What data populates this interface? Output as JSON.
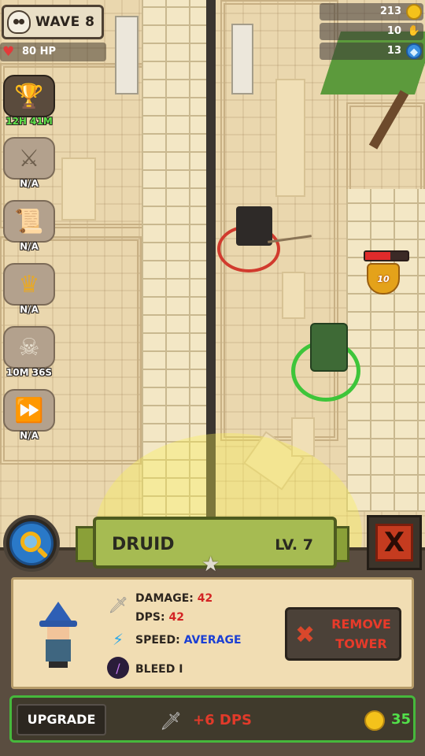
{
  "hud": {
    "wave_label": "WAVE 8",
    "hp_label": "80 HP"
  },
  "resources": [
    {
      "value": "213",
      "icon": "coin-icon"
    },
    {
      "value": "10",
      "icon": "hand-icon"
    },
    {
      "value": "13",
      "icon": "gem-icon"
    }
  ],
  "abilities": [
    {
      "label": "12H 41M",
      "icon": "trophy-icon",
      "active": true
    },
    {
      "label": "N/A",
      "icon": "crossed-swords-icon"
    },
    {
      "label": "N/A",
      "icon": "scroll-icon"
    },
    {
      "label": "N/A",
      "icon": "crown-icon"
    },
    {
      "label": "10M 36S",
      "icon": "skull-icon"
    },
    {
      "label": "N/A",
      "icon": "fast-forward-icon"
    }
  ],
  "enemy": {
    "damage_popup": "10",
    "health_fraction": 0.6
  },
  "tower": {
    "name": "DRUID",
    "level": "LV. 7",
    "stats": {
      "damage_label": "DAMAGE:",
      "damage_value": "42",
      "dps_label": "DPS:",
      "dps_value": "42",
      "speed_label": "SPEED:",
      "speed_value": "AVERAGE",
      "effect": "BLEED I"
    },
    "remove_label_line1": "REMOVE",
    "remove_label_line2": "TOWER"
  },
  "upgrade": {
    "button_label": "UPGRADE",
    "gain": "+6 DPS",
    "cost": "35"
  },
  "colors": {
    "accent_green": "#46b83c",
    "damage_red": "#d32424",
    "speed_blue": "#1b3fd3",
    "banner_green": "#a6bb52"
  }
}
